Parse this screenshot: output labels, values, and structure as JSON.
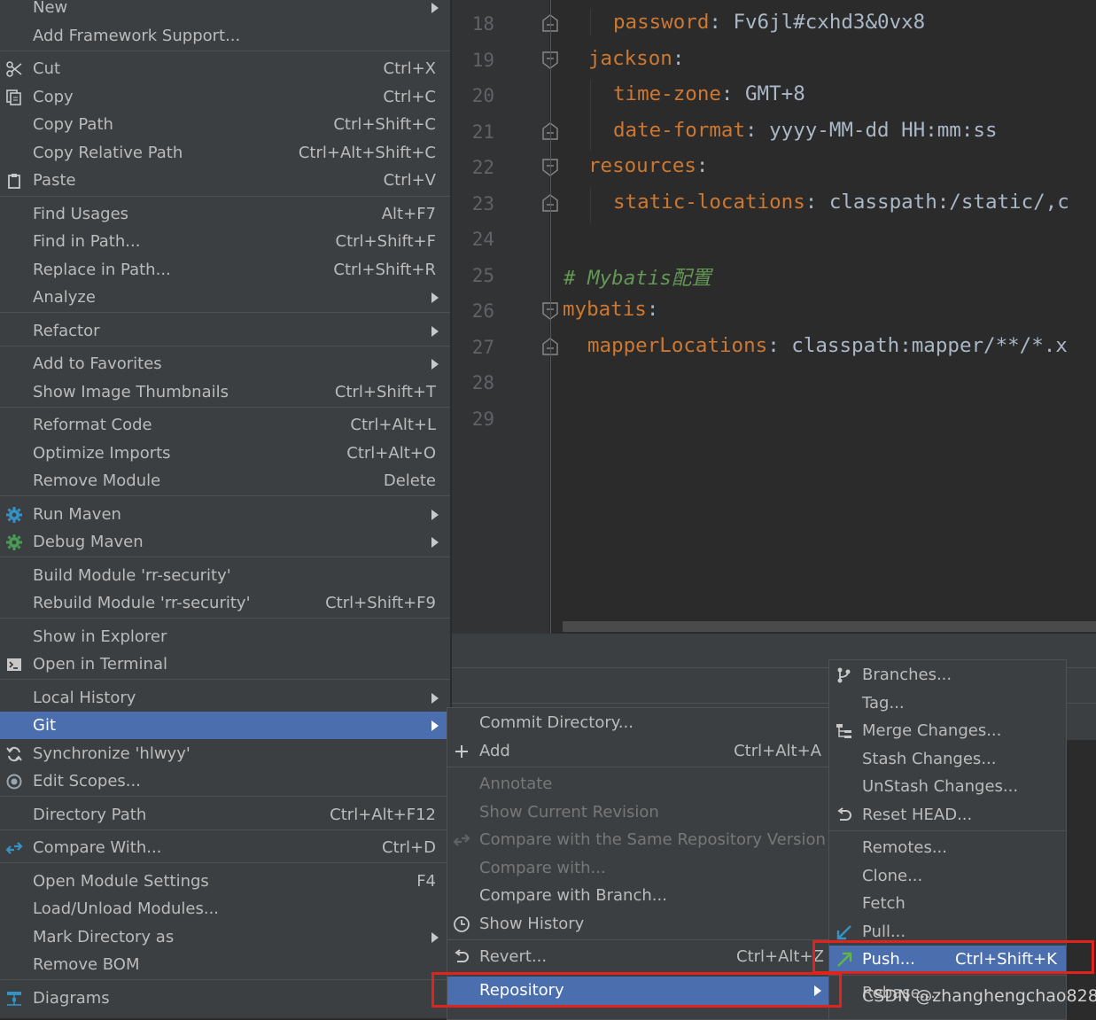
{
  "editor": {
    "line_numbers": [
      "18",
      "19",
      "20",
      "21",
      "22",
      "23",
      "24",
      "25",
      "26",
      "27",
      "28",
      "29"
    ],
    "lines": [
      {
        "key": "password",
        "sep": ": ",
        "value": "Fv6jl#cxhd3&0vx8"
      },
      {
        "key": "jackson",
        "sep": ":",
        "value": ""
      },
      {
        "key": "time-zone",
        "sep": ": ",
        "value": "GMT+8"
      },
      {
        "key": "date-format",
        "sep": ": ",
        "value": "yyyy-MM-dd HH:mm:ss"
      },
      {
        "key": "resources",
        "sep": ":",
        "value": ""
      },
      {
        "key": "static-locations",
        "sep": ": ",
        "value": "classpath:/static/,c"
      },
      {
        "comment": "# Mybatis配置"
      },
      {
        "key": "mybatis",
        "sep": ":",
        "value": ""
      },
      {
        "key": "mapperLocations",
        "sep": ": ",
        "value": "classpath:mapper/**/*.x"
      }
    ]
  },
  "context_menu": {
    "new": "New",
    "add_framework": "Add Framework Support...",
    "cut": {
      "label": "Cut",
      "shortcut": "Ctrl+X"
    },
    "copy": {
      "label": "Copy",
      "shortcut": "Ctrl+C"
    },
    "copy_path": {
      "label": "Copy Path",
      "shortcut": "Ctrl+Shift+C"
    },
    "copy_relative_path": {
      "label": "Copy Relative Path",
      "shortcut": "Ctrl+Alt+Shift+C"
    },
    "paste": {
      "label": "Paste",
      "shortcut": "Ctrl+V"
    },
    "find_usages": {
      "label": "Find Usages",
      "shortcut": "Alt+F7"
    },
    "find_in_path": {
      "label": "Find in Path...",
      "shortcut": "Ctrl+Shift+F"
    },
    "replace_in_path": {
      "label": "Replace in Path...",
      "shortcut": "Ctrl+Shift+R"
    },
    "analyze": "Analyze",
    "refactor": "Refactor",
    "add_to_favorites": "Add to Favorites",
    "show_thumbnails": {
      "label": "Show Image Thumbnails",
      "shortcut": "Ctrl+Shift+T"
    },
    "reformat_code": {
      "label": "Reformat Code",
      "shortcut": "Ctrl+Alt+L"
    },
    "optimize_imports": {
      "label": "Optimize Imports",
      "shortcut": "Ctrl+Alt+O"
    },
    "remove_module": {
      "label": "Remove Module",
      "shortcut": "Delete"
    },
    "run_maven": "Run Maven",
    "debug_maven": "Debug Maven",
    "build_module": "Build Module 'rr-security'",
    "rebuild_module": {
      "label": "Rebuild Module 'rr-security'",
      "shortcut": "Ctrl+Shift+F9"
    },
    "show_in_explorer": "Show in Explorer",
    "open_in_terminal": "Open in Terminal",
    "local_history": "Local History",
    "git": "Git",
    "synchronize": "Synchronize 'hlwyy'",
    "edit_scopes": "Edit Scopes...",
    "directory_path": {
      "label": "Directory Path",
      "shortcut": "Ctrl+Alt+F12"
    },
    "compare_with": {
      "label": "Compare With...",
      "shortcut": "Ctrl+D"
    },
    "open_module_settings": {
      "label": "Open Module Settings",
      "shortcut": "F4"
    },
    "load_unload_modules": "Load/Unload Modules...",
    "mark_directory_as": "Mark Directory as",
    "remove_bom": "Remove BOM",
    "diagrams": "Diagrams"
  },
  "git_menu": {
    "commit_directory": "Commit Directory...",
    "add": {
      "label": "Add",
      "shortcut": "Ctrl+Alt+A"
    },
    "annotate": "Annotate",
    "show_current_revision": "Show Current Revision",
    "compare_same_repo": "Compare with the Same Repository Version",
    "compare_with": "Compare with...",
    "compare_with_branch": "Compare with Branch...",
    "show_history": "Show History",
    "revert": {
      "label": "Revert...",
      "shortcut": "Ctrl+Alt+Z"
    },
    "repository": "Repository"
  },
  "repository_menu": {
    "branches": "Branches...",
    "tag": "Tag...",
    "merge_changes": "Merge Changes...",
    "stash_changes": "Stash Changes...",
    "unstash_changes": "UnStash Changes...",
    "reset_head": "Reset HEAD...",
    "remotes": "Remotes...",
    "clone": "Clone...",
    "fetch": "Fetch",
    "pull": "Pull...",
    "push": {
      "label": "Push...",
      "shortcut": "Ctrl+Shift+K"
    },
    "rebase": "Rebase..."
  },
  "watermark": "CSDN @zhanghengchao828",
  "colors": {
    "menu_bg": "#3c3f41",
    "selection": "#4b6eaf",
    "highlight_box": "#e0231c",
    "yaml_key": "#cc7832",
    "comment": "#629755"
  }
}
